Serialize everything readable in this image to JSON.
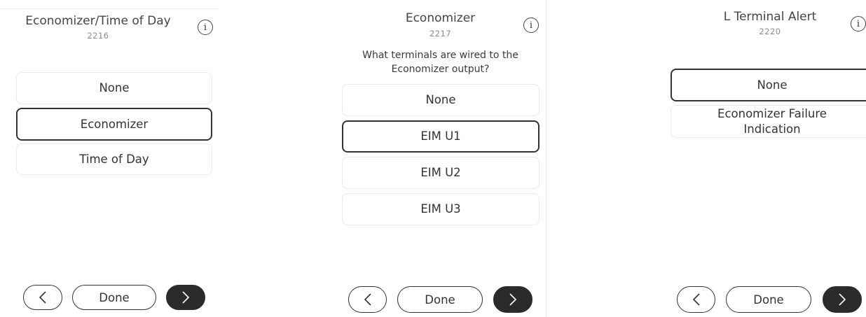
{
  "screens": [
    {
      "title": "Economizer/Time of Day",
      "code": "2216",
      "question": "",
      "options": [
        "None",
        "Economizer",
        "Time of Day"
      ],
      "selected": "Economizer",
      "nav": {
        "back_icon": "chevron-left-icon",
        "done_label": "Done",
        "next_icon": "chevron-right-icon"
      }
    },
    {
      "title": "Economizer",
      "code": "2217",
      "question": "What terminals are wired to the Economizer output?",
      "options": [
        "None",
        "EIM U1",
        "EIM U2",
        "EIM U3"
      ],
      "selected": "EIM U1",
      "nav": {
        "back_icon": "chevron-left-icon",
        "done_label": "Done",
        "next_icon": "chevron-right-icon"
      }
    },
    {
      "title": "L Terminal Alert",
      "code": "2220",
      "question": "",
      "options": [
        "None",
        "Economizer Failure Indication"
      ],
      "selected": "None",
      "nav": {
        "back_icon": "chevron-left-icon",
        "done_label": "Done",
        "next_icon": "chevron-right-icon"
      }
    }
  ],
  "icons": {
    "info": "info-icon"
  },
  "colors": {
    "text": "#333333",
    "code": "#8a8a8a",
    "border": "#ebebeb",
    "selected_border": "#333333",
    "next_button": "#2b2b2b"
  }
}
